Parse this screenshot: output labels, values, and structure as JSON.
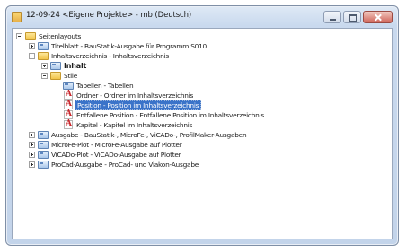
{
  "window": {
    "title": "12-09-24 <Eigene Projekte> - mb (Deutsch)"
  },
  "tree": {
    "root_label": "Seitenlayouts",
    "items": [
      {
        "label": "Titelblatt - BauStatik-Ausgabe für Programm S010",
        "icon": "page-icon",
        "expander": "plus"
      },
      {
        "label": "Inhaltsverzeichnis - Inhaltsverzeichnis",
        "icon": "folder-icon",
        "expander": "minus"
      },
      {
        "label": "Inhalt",
        "icon": "page-icon",
        "expander": "plus"
      },
      {
        "label": "Stile",
        "icon": "folder-icon",
        "expander": "minus"
      },
      {
        "label": "Tabellen - Tabellen",
        "icon": "page-icon"
      },
      {
        "label": "Ordner - Ordner im Inhaltsverzeichnis",
        "icon": "a-icon"
      },
      {
        "label": "Position - Position im Inhaltsverzeichnis",
        "icon": "a-icon",
        "selected": true
      },
      {
        "label": "Entfallene Position - Entfallene Position im Inhaltsverzeichnis",
        "icon": "a-icon"
      },
      {
        "label": "Kapitel - Kapitel im Inhaltsverzeichnis",
        "icon": "a-icon"
      },
      {
        "label": "Ausgabe - BauStatik-, MicroFe-, ViCADo-, ProfilMaker-Ausgaben",
        "icon": "page-icon",
        "expander": "plus"
      },
      {
        "label": "MicroFe-Plot - MicroFe-Ausgabe auf Plotter",
        "icon": "page-icon",
        "expander": "plus"
      },
      {
        "label": "ViCADo-Plot - ViCADo-Ausgabe auf Plotter",
        "icon": "page-icon",
        "expander": "plus"
      },
      {
        "label": "ProCad-Ausgabe - ProCad- und Viakon-Ausgabe",
        "icon": "page-icon",
        "expander": "plus"
      }
    ]
  }
}
